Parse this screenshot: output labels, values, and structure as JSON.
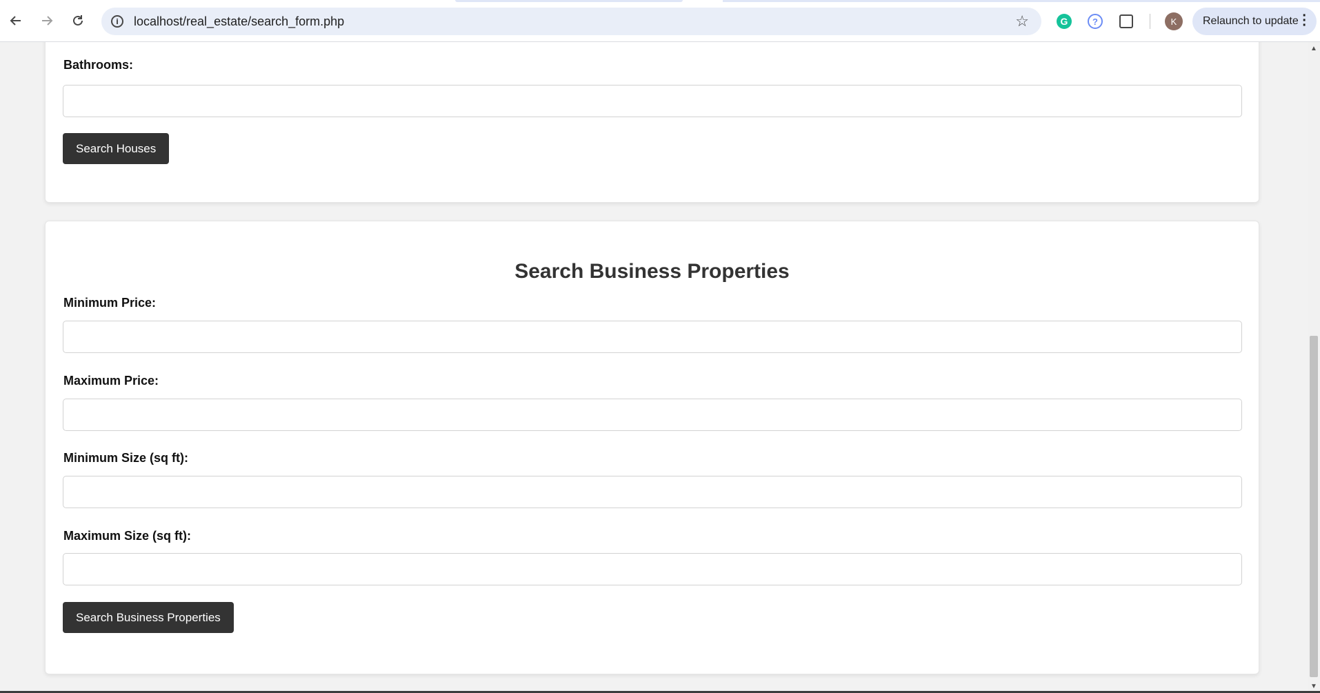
{
  "browser": {
    "url": "localhost/real_estate/search_form.php",
    "avatar_letter": "K",
    "relaunch_label": "Relaunch to update",
    "grammarly_letter": "G",
    "help_glyph": "?"
  },
  "house_form": {
    "bathrooms_label": "Bathrooms:",
    "bathrooms_value": "",
    "submit_label": "Search Houses"
  },
  "business_form": {
    "title": "Search Business Properties",
    "min_price_label": "Minimum Price:",
    "max_price_label": "Maximum Price:",
    "min_size_label": "Minimum Size (sq ft):",
    "max_size_label": "Maximum Size (sq ft):",
    "submit_label": "Search Business Properties"
  },
  "icons": {
    "back": "arrow-left-icon",
    "forward": "arrow-right-icon",
    "reload": "reload-icon",
    "site_info": "info-icon",
    "bookmark": "star-icon",
    "extensions": "puzzle-icon",
    "menu": "kebab-icon"
  }
}
